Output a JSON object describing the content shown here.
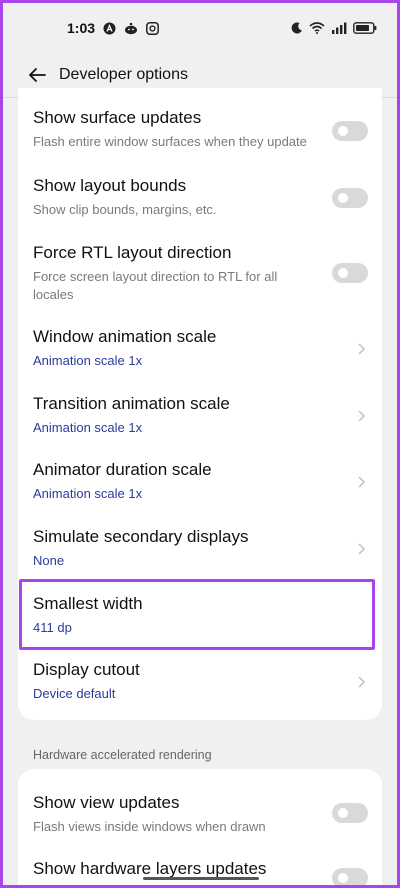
{
  "status_bar": {
    "time": "1:03",
    "icons_left": [
      "autonomous-icon",
      "reddit-icon",
      "app-icon"
    ],
    "icons_right": [
      "moon-icon",
      "wifi-icon",
      "signal-icon",
      "battery-icon"
    ]
  },
  "app_bar": {
    "title": "Developer options",
    "back_icon": "arrow-left-icon"
  },
  "rows": [
    {
      "title": "Show surface updates",
      "subtitle": "Flash entire window surfaces when they update",
      "control": "toggle",
      "checked": false
    },
    {
      "title": "Show layout bounds",
      "subtitle": "Show clip bounds, margins, etc.",
      "control": "toggle",
      "checked": false
    },
    {
      "title": "Force RTL layout direction",
      "subtitle": "Force screen layout direction to RTL for all locales",
      "control": "toggle",
      "checked": false
    },
    {
      "title": "Window animation scale",
      "value": "Animation scale 1x",
      "control": "chevron"
    },
    {
      "title": "Transition animation scale",
      "value": "Animation scale 1x",
      "control": "chevron"
    },
    {
      "title": "Animator duration scale",
      "value": "Animation scale 1x",
      "control": "chevron"
    },
    {
      "title": "Simulate secondary displays",
      "value": "None",
      "control": "chevron"
    },
    {
      "title": "Smallest width",
      "value": "411 dp",
      "control": "none",
      "highlighted": true
    },
    {
      "title": "Display cutout",
      "value": "Device default",
      "control": "chevron"
    }
  ],
  "section": {
    "header": "Hardware accelerated rendering",
    "rows": [
      {
        "title": "Show view updates",
        "subtitle": "Flash views inside windows when drawn",
        "control": "toggle",
        "checked": false
      },
      {
        "title": "Show hardware layers updates",
        "control": "toggle",
        "checked": false
      }
    ]
  },
  "colors": {
    "highlight": "#a545ea",
    "value_text": "#2b3b9c",
    "toggle_off": "#d9d9d9"
  }
}
